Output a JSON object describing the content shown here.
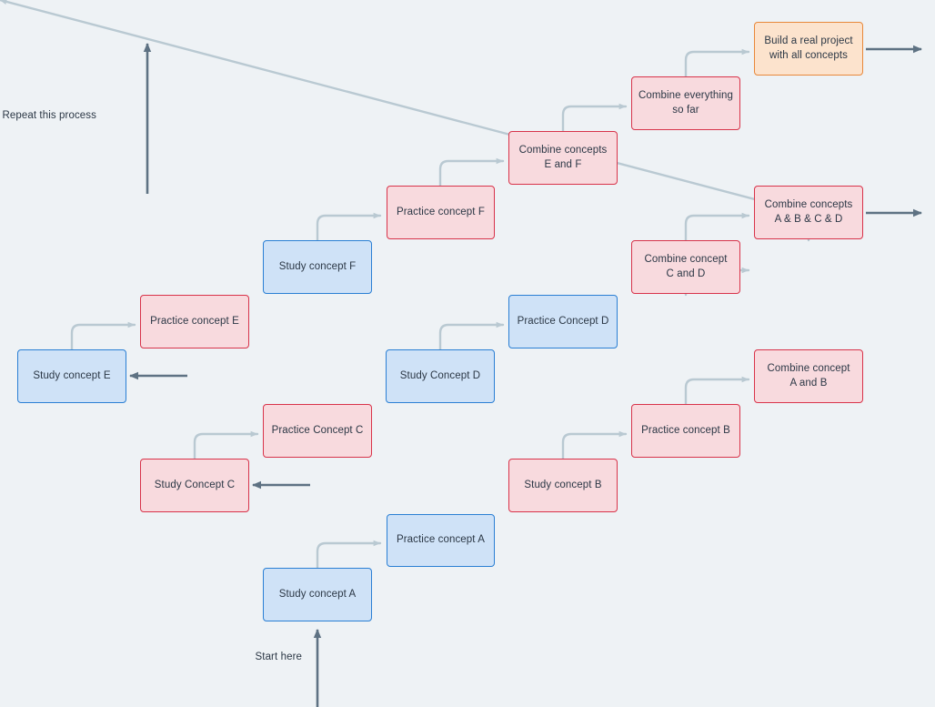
{
  "diagram": {
    "title": "Spaced learning concept loop flowchart",
    "background_color": "#eef2f5",
    "colors": {
      "blue_fill": "#cfe2f7",
      "blue_border": "#2a7fd4",
      "pink_fill": "#f8dade",
      "pink_border": "#d8334a",
      "orange_fill": "#fce3cd",
      "orange_border": "#e8883a",
      "soft_connector": "#b9c9d2",
      "strong_connector": "#5e7283",
      "text": "#2b3745"
    }
  },
  "annotations": [
    {
      "id": "repeat",
      "text": "Repeat this process"
    },
    {
      "id": "start",
      "text": "Start here"
    }
  ],
  "nodes": [
    {
      "id": "study-a",
      "label": "Study concept A",
      "style": "blue"
    },
    {
      "id": "practice-a",
      "label": "Practice concept A",
      "style": "blue"
    },
    {
      "id": "study-b",
      "label": "Study concept B",
      "style": "pink"
    },
    {
      "id": "practice-b",
      "label": "Practice concept B",
      "style": "pink"
    },
    {
      "id": "combine-ab",
      "label": "Combine concept\nA and B",
      "style": "pink"
    },
    {
      "id": "study-c",
      "label": "Study Concept C",
      "style": "pink"
    },
    {
      "id": "practice-c",
      "label": "Practice Concept C",
      "style": "pink"
    },
    {
      "id": "study-d",
      "label": "Study Concept D",
      "style": "blue"
    },
    {
      "id": "practice-d",
      "label": "Practice Concept D",
      "style": "blue"
    },
    {
      "id": "combine-cd",
      "label": "Combine concept\nC and D",
      "style": "pink"
    },
    {
      "id": "combine-abcd",
      "label": "Combine concepts\nA & B & C & D",
      "style": "pink"
    },
    {
      "id": "study-e",
      "label": "Study concept E",
      "style": "blue"
    },
    {
      "id": "practice-e",
      "label": "Practice concept E",
      "style": "pink"
    },
    {
      "id": "study-f",
      "label": "Study concept F",
      "style": "blue"
    },
    {
      "id": "practice-f",
      "label": "Practice concept F",
      "style": "pink"
    },
    {
      "id": "combine-ef",
      "label": "Combine concepts\nE and F",
      "style": "pink"
    },
    {
      "id": "combine-all",
      "label": "Combine everything\nso far",
      "style": "pink"
    },
    {
      "id": "build-project",
      "label": "Build a real project\nwith all concepts",
      "style": "orange"
    }
  ]
}
